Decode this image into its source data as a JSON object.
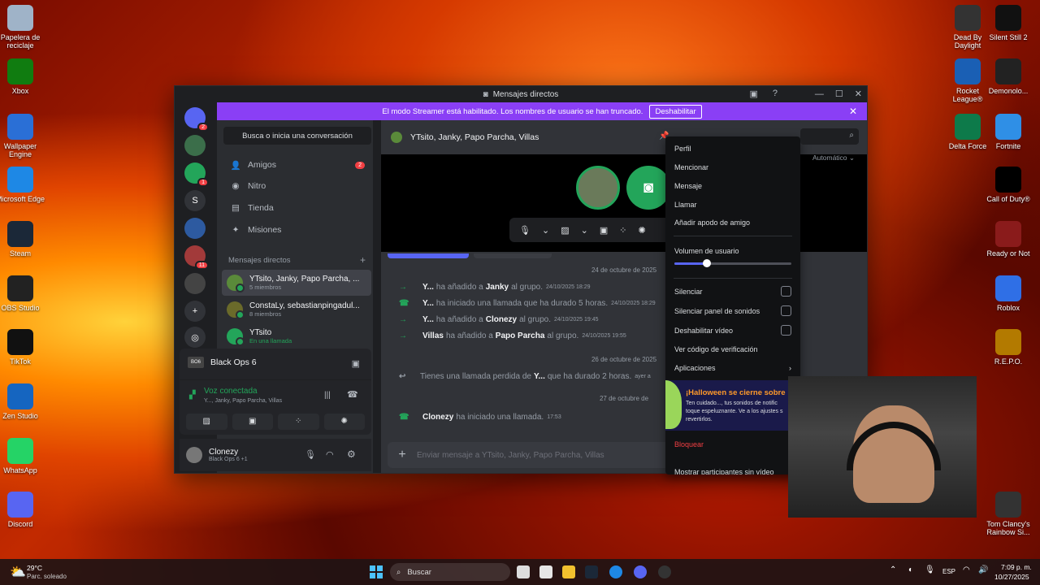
{
  "desktop_left": [
    {
      "label": "Papelera de reciclaje",
      "icon": "recycle-bin-icon",
      "color": "#9fb3c8"
    },
    {
      "label": "Xbox",
      "icon": "xbox-icon",
      "color": "#107c10"
    },
    {
      "label": "Wallpaper Engine",
      "icon": "wallpaper-engine-icon",
      "color": "#2a6fd6"
    },
    {
      "label": "Microsoft Edge",
      "icon": "edge-icon",
      "color": "#1e88e5"
    },
    {
      "label": "Steam",
      "icon": "steam-icon",
      "color": "#1b2838"
    },
    {
      "label": "OBS Studio",
      "icon": "obs-icon",
      "color": "#222"
    },
    {
      "label": "TikTok",
      "icon": "tiktok-icon",
      "color": "#111"
    },
    {
      "label": "Zen Studio",
      "icon": "zen-icon",
      "color": "#1565c0"
    },
    {
      "label": "WhatsApp",
      "icon": "whatsapp-icon",
      "color": "#25d366"
    },
    {
      "label": "Discord",
      "icon": "discord-icon",
      "color": "#5865f2"
    }
  ],
  "desktop_right": [
    {
      "label": "Dead By Daylight",
      "icon": "dbd-icon",
      "color": "#333"
    },
    {
      "label": "Silent Still 2",
      "icon": "silent-still-icon",
      "color": "#111"
    },
    {
      "label": "Rocket League®",
      "icon": "rocket-league-icon",
      "color": "#1a5fb4"
    },
    {
      "label": "Demonolo...",
      "icon": "demonologist-icon",
      "color": "#222"
    },
    {
      "label": "Delta Force",
      "icon": "delta-force-icon",
      "color": "#0d7a4a"
    },
    {
      "label": "Fortnite",
      "icon": "fortnite-icon",
      "color": "#2f8fe6"
    },
    {
      "label": "Call of Duty®",
      "icon": "cod-icon",
      "color": "#000"
    },
    {
      "label": "Ready or Not",
      "icon": "ready-or-not-icon",
      "color": "#8a1b1b"
    },
    {
      "label": "Roblox",
      "icon": "roblox-icon",
      "color": "#2f6fe6"
    },
    {
      "label": "R.E.P.O.",
      "icon": "repo-icon",
      "color": "#b37a00"
    },
    {
      "label": "Tom Clancy's Rainbow Si...",
      "icon": "rainbow-six-icon",
      "color": "#333"
    }
  ],
  "window": {
    "title": "Mensajes directos",
    "banner_text": "El modo Streamer está habilitado. Los nombres de usuario se han truncado.",
    "banner_button": "Deshabilitar"
  },
  "servers": [
    {
      "badge": "2",
      "color": "#5865f2"
    },
    {
      "badge": "",
      "color": "#3b6e4a"
    },
    {
      "badge": "1",
      "color": "#23a55a"
    },
    {
      "badge": "",
      "color": "#313338",
      "letter": "S"
    },
    {
      "badge": "",
      "color": "#2d5aa0"
    },
    {
      "badge": "11",
      "color": "#a23a3a"
    },
    {
      "badge": "",
      "color": "#444"
    }
  ],
  "sidebar": {
    "search": "Busca o inicia una conversación",
    "nav": [
      {
        "label": "Amigos",
        "icon": "friends-icon",
        "count": "2"
      },
      {
        "label": "Nitro",
        "icon": "nitro-icon",
        "count": ""
      },
      {
        "label": "Tienda",
        "icon": "shop-icon",
        "count": ""
      },
      {
        "label": "Misiones",
        "icon": "quests-icon",
        "count": ""
      }
    ],
    "dm_header": "Mensajes directos",
    "dms": [
      {
        "name": "YTsito, Janky, Papo Parcha, ...",
        "sub": "5 miembros",
        "color": "#5a8a3a"
      },
      {
        "name": "ConstaLy, sebastianpingadul...",
        "sub": "8 miembros",
        "color": "#6a6a2a"
      },
      {
        "name": "YTsito",
        "sub": "En una llamada",
        "color": "#23a55a"
      }
    ]
  },
  "activity": {
    "game": "Black Ops 6",
    "voice_status": "Voz conectada",
    "voice_channel": "Y..., Janky, Papo Parcha, Villas"
  },
  "user": {
    "name": "Clonezy",
    "status": "Black Ops 6 +1"
  },
  "chat": {
    "header": "YTsito, Janky, Papo Parcha, Villas",
    "search_mode": "Automático",
    "messages": [
      {
        "date": "24 de octubre de 2025"
      },
      {
        "type": "join",
        "who": "Y...",
        "text1": "ha añadido a",
        "target": "Janky",
        "text2": "al grupo.",
        "ts": "24/10/2025 18:29"
      },
      {
        "type": "call",
        "who": "Y...",
        "text1": "ha iniciado una llamada que ha durado 5 horas.",
        "target": "",
        "text2": "",
        "ts": "24/10/2025 18:29"
      },
      {
        "type": "join",
        "who": "Y...",
        "text1": "ha añadido a",
        "target": "Clonezy",
        "text2": "al grupo.",
        "ts": "24/10/2025 19:45"
      },
      {
        "type": "join",
        "who": "Villas",
        "text1": "ha añadido a",
        "target": "Papo Parcha",
        "text2": "al grupo.",
        "ts": "24/10/2025 19:55"
      },
      {
        "date": "26 de octubre de 2025"
      },
      {
        "type": "missed",
        "who": "",
        "text1": "Tienes una llamada perdida de",
        "target": "Y...",
        "text2": "que ha durado 2 horas.",
        "ts": "ayer a"
      },
      {
        "date": "27 de octubre de"
      },
      {
        "type": "call",
        "who": "Clonezy",
        "text1": "ha iniciado una llamada.",
        "target": "",
        "text2": "",
        "ts": "17:53"
      }
    ],
    "input_placeholder": "Enviar mensaje a YTsito, Janky, Papo Parcha, Villas"
  },
  "context_menu": {
    "items": [
      "Perfil",
      "Mencionar",
      "Mensaje",
      "Llamar",
      "Añadir apodo de amigo"
    ],
    "volume_label": "Volumen de usuario",
    "volume": 0.28,
    "toggles": [
      "Silenciar",
      "Silenciar panel de sonidos",
      "Deshabilitar vídeo"
    ],
    "verify": "Ver código de verificación",
    "apps": "Aplicaciones",
    "halloween_title": "¡Halloween se cierne sobre",
    "halloween_body": "Ten cuidado..., tus sonidos de notific toque espeluznante. Ve a los ajustes s revertirlos.",
    "block": "Bloquear",
    "show_participants": "Mostrar participantes sin vídeo"
  },
  "taskbar": {
    "weather_temp": "29°C",
    "weather_text": "Parc. soleado",
    "search": "Buscar",
    "lang": "ESP",
    "time": "7:09 p. m.",
    "date": "10/27/2025"
  }
}
